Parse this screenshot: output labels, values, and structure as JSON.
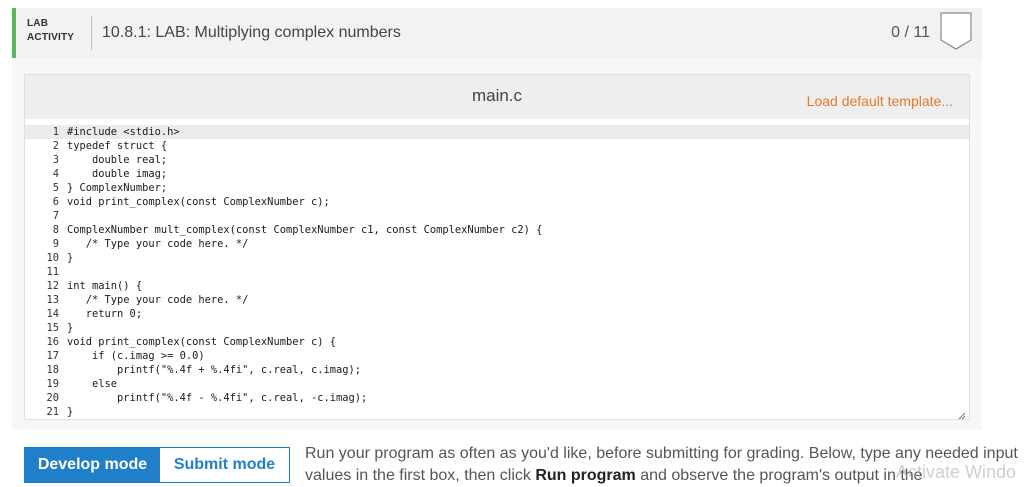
{
  "lab": {
    "tag_line1": "LAB",
    "tag_line2": "ACTIVITY",
    "title": "10.8.1: LAB: Multiplying complex numbers",
    "score": "0 / 11",
    "accent_color": "#5cb85c",
    "badge_icon": "shield-badge-icon"
  },
  "editor": {
    "file_name": "main.c",
    "load_template_label": "Load default template...",
    "active_line": 1,
    "lines": [
      "#include <stdio.h>",
      "typedef struct {",
      "    double real;",
      "    double imag;",
      "} ComplexNumber;",
      "void print_complex(const ComplexNumber c);",
      "",
      "ComplexNumber mult_complex(const ComplexNumber c1, const ComplexNumber c2) {",
      "   /* Type your code here. */",
      "}",
      "",
      "int main() {",
      "   /* Type your code here. */",
      "   return 0;",
      "}",
      "void print_complex(const ComplexNumber c) {",
      "    if (c.imag >= 0.0)",
      "        printf(\"%.4f + %.4fi\", c.real, c.imag);",
      "    else",
      "        printf(\"%.4f - %.4fi\", c.real, -c.imag);",
      "}"
    ]
  },
  "modes": {
    "develop_label": "Develop mode",
    "submit_label": "Submit mode",
    "active": "develop",
    "accent_color": "#1f7fc8"
  },
  "instructions": {
    "part1": "Run your program as often as you'd like, before submitting for grading. Below, type any needed input values in the first box, then click ",
    "run_label": "Run program",
    "part2": " and observe the program's output in the"
  },
  "watermark": "Activate Windo"
}
